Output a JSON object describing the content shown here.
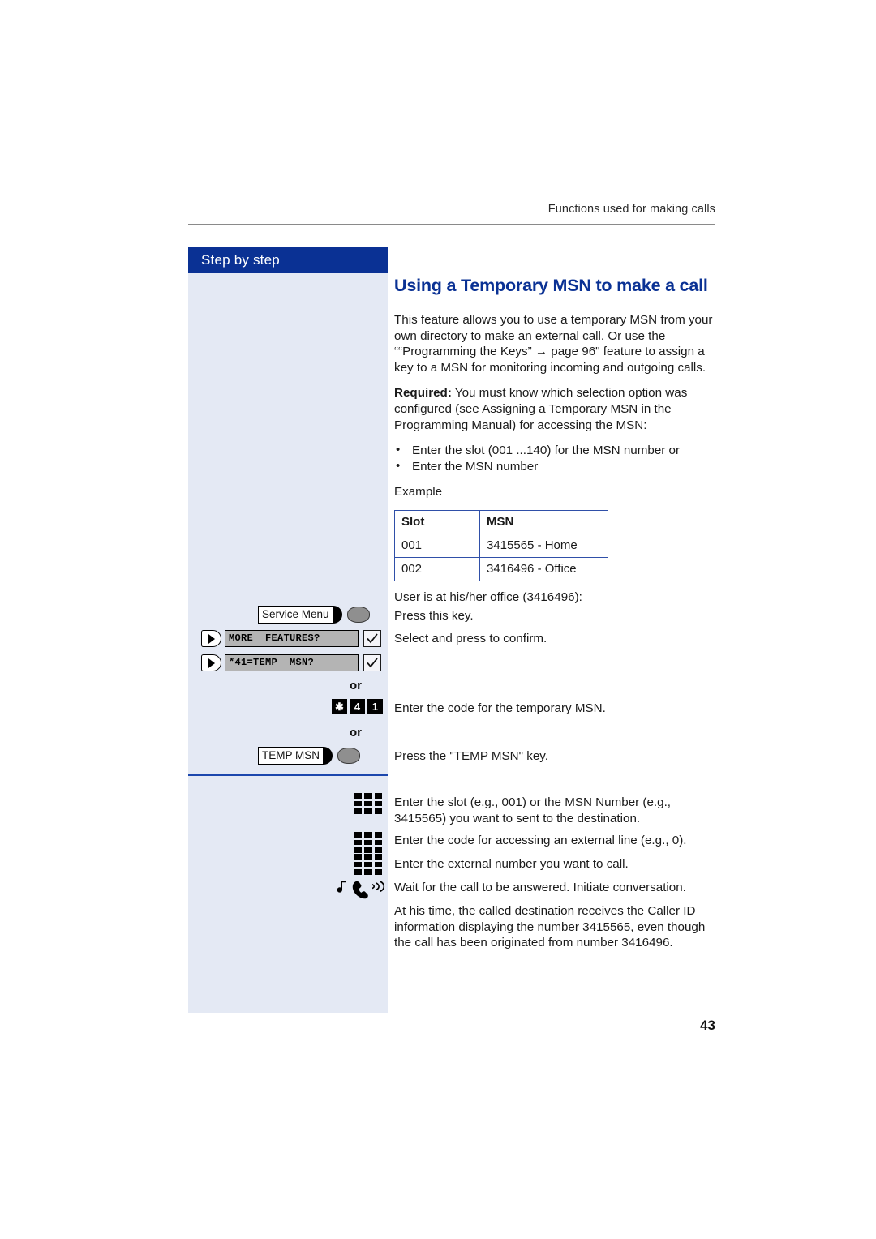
{
  "header": {
    "running_head": "Functions used for making calls"
  },
  "sidebar": {
    "title": "Step by step",
    "steps": [
      {
        "type": "function-key",
        "label": "Service Menu",
        "icon": "function-key-led-icon"
      },
      {
        "type": "menu-row",
        "display": "MORE  FEATURES?",
        "arrow_icon": "next-arrow-icon",
        "confirm_icon": "checkmark-icon"
      },
      {
        "type": "menu-row",
        "display": "*41=TEMP  MSN?",
        "arrow_icon": "next-arrow-icon",
        "confirm_icon": "checkmark-icon"
      },
      {
        "type": "or",
        "label": "or"
      },
      {
        "type": "keys",
        "keys": [
          "✱",
          "4",
          "1"
        ]
      },
      {
        "type": "or",
        "label": "or"
      },
      {
        "type": "function-key",
        "label": "TEMP MSN",
        "icon": "function-key-led-icon"
      },
      {
        "type": "keypad",
        "icon": "keypad-icon"
      },
      {
        "type": "keypad",
        "icon": "keypad-icon"
      },
      {
        "type": "keypad",
        "icon": "keypad-icon"
      },
      {
        "type": "ring",
        "icon": "handset-ringing-icon"
      }
    ]
  },
  "content": {
    "title": "Using a Temporary MSN to make a call",
    "intro": "This feature allows you to use a temporary MSN from your own directory to make an external call. Or use the ““Programming the Keys” → page 96\" feature to assign a key to a MSN for monitoring incoming and outgoing calls.",
    "required_label": "Required:",
    "required_text": " You must know which selection option was configured (see Assigning a Temporary MSN in the Programming Manual) for accessing the MSN:",
    "bullets": [
      "Enter the slot (001 ...140) for the MSN number or",
      "Enter the MSN number"
    ],
    "example_label": "Example",
    "table": {
      "headers": [
        "Slot",
        "MSN"
      ],
      "rows": [
        [
          "001",
          "3415565 - Home"
        ],
        [
          "002",
          "3416496 - Office"
        ]
      ]
    },
    "user_note": "User is at his/her office (3416496):",
    "steps": [
      "Press this key.",
      "Select and press to confirm.",
      "Enter the code for the temporary MSN.",
      "Press the \"TEMP MSN\" key.",
      "Enter the slot (e.g., 001) or the MSN Number (e.g., 3415565) you want to sent to the destination.",
      "Enter the code for accessing an external line (e.g., 0).",
      "Enter the external number you want to call.",
      "Wait for the call to be answered. Initiate conversation.",
      "At his time, the called destination receives the Caller ID information displaying the number 3415565, even though the call has been originated from number 3416496."
    ]
  },
  "footer": {
    "page_number": "43"
  },
  "colors": {
    "brand_blue": "#0a3194",
    "sidebar_bg": "#e4e9f4",
    "divider_blue": "#1c47ad",
    "table_border": "#2f4fa8"
  }
}
